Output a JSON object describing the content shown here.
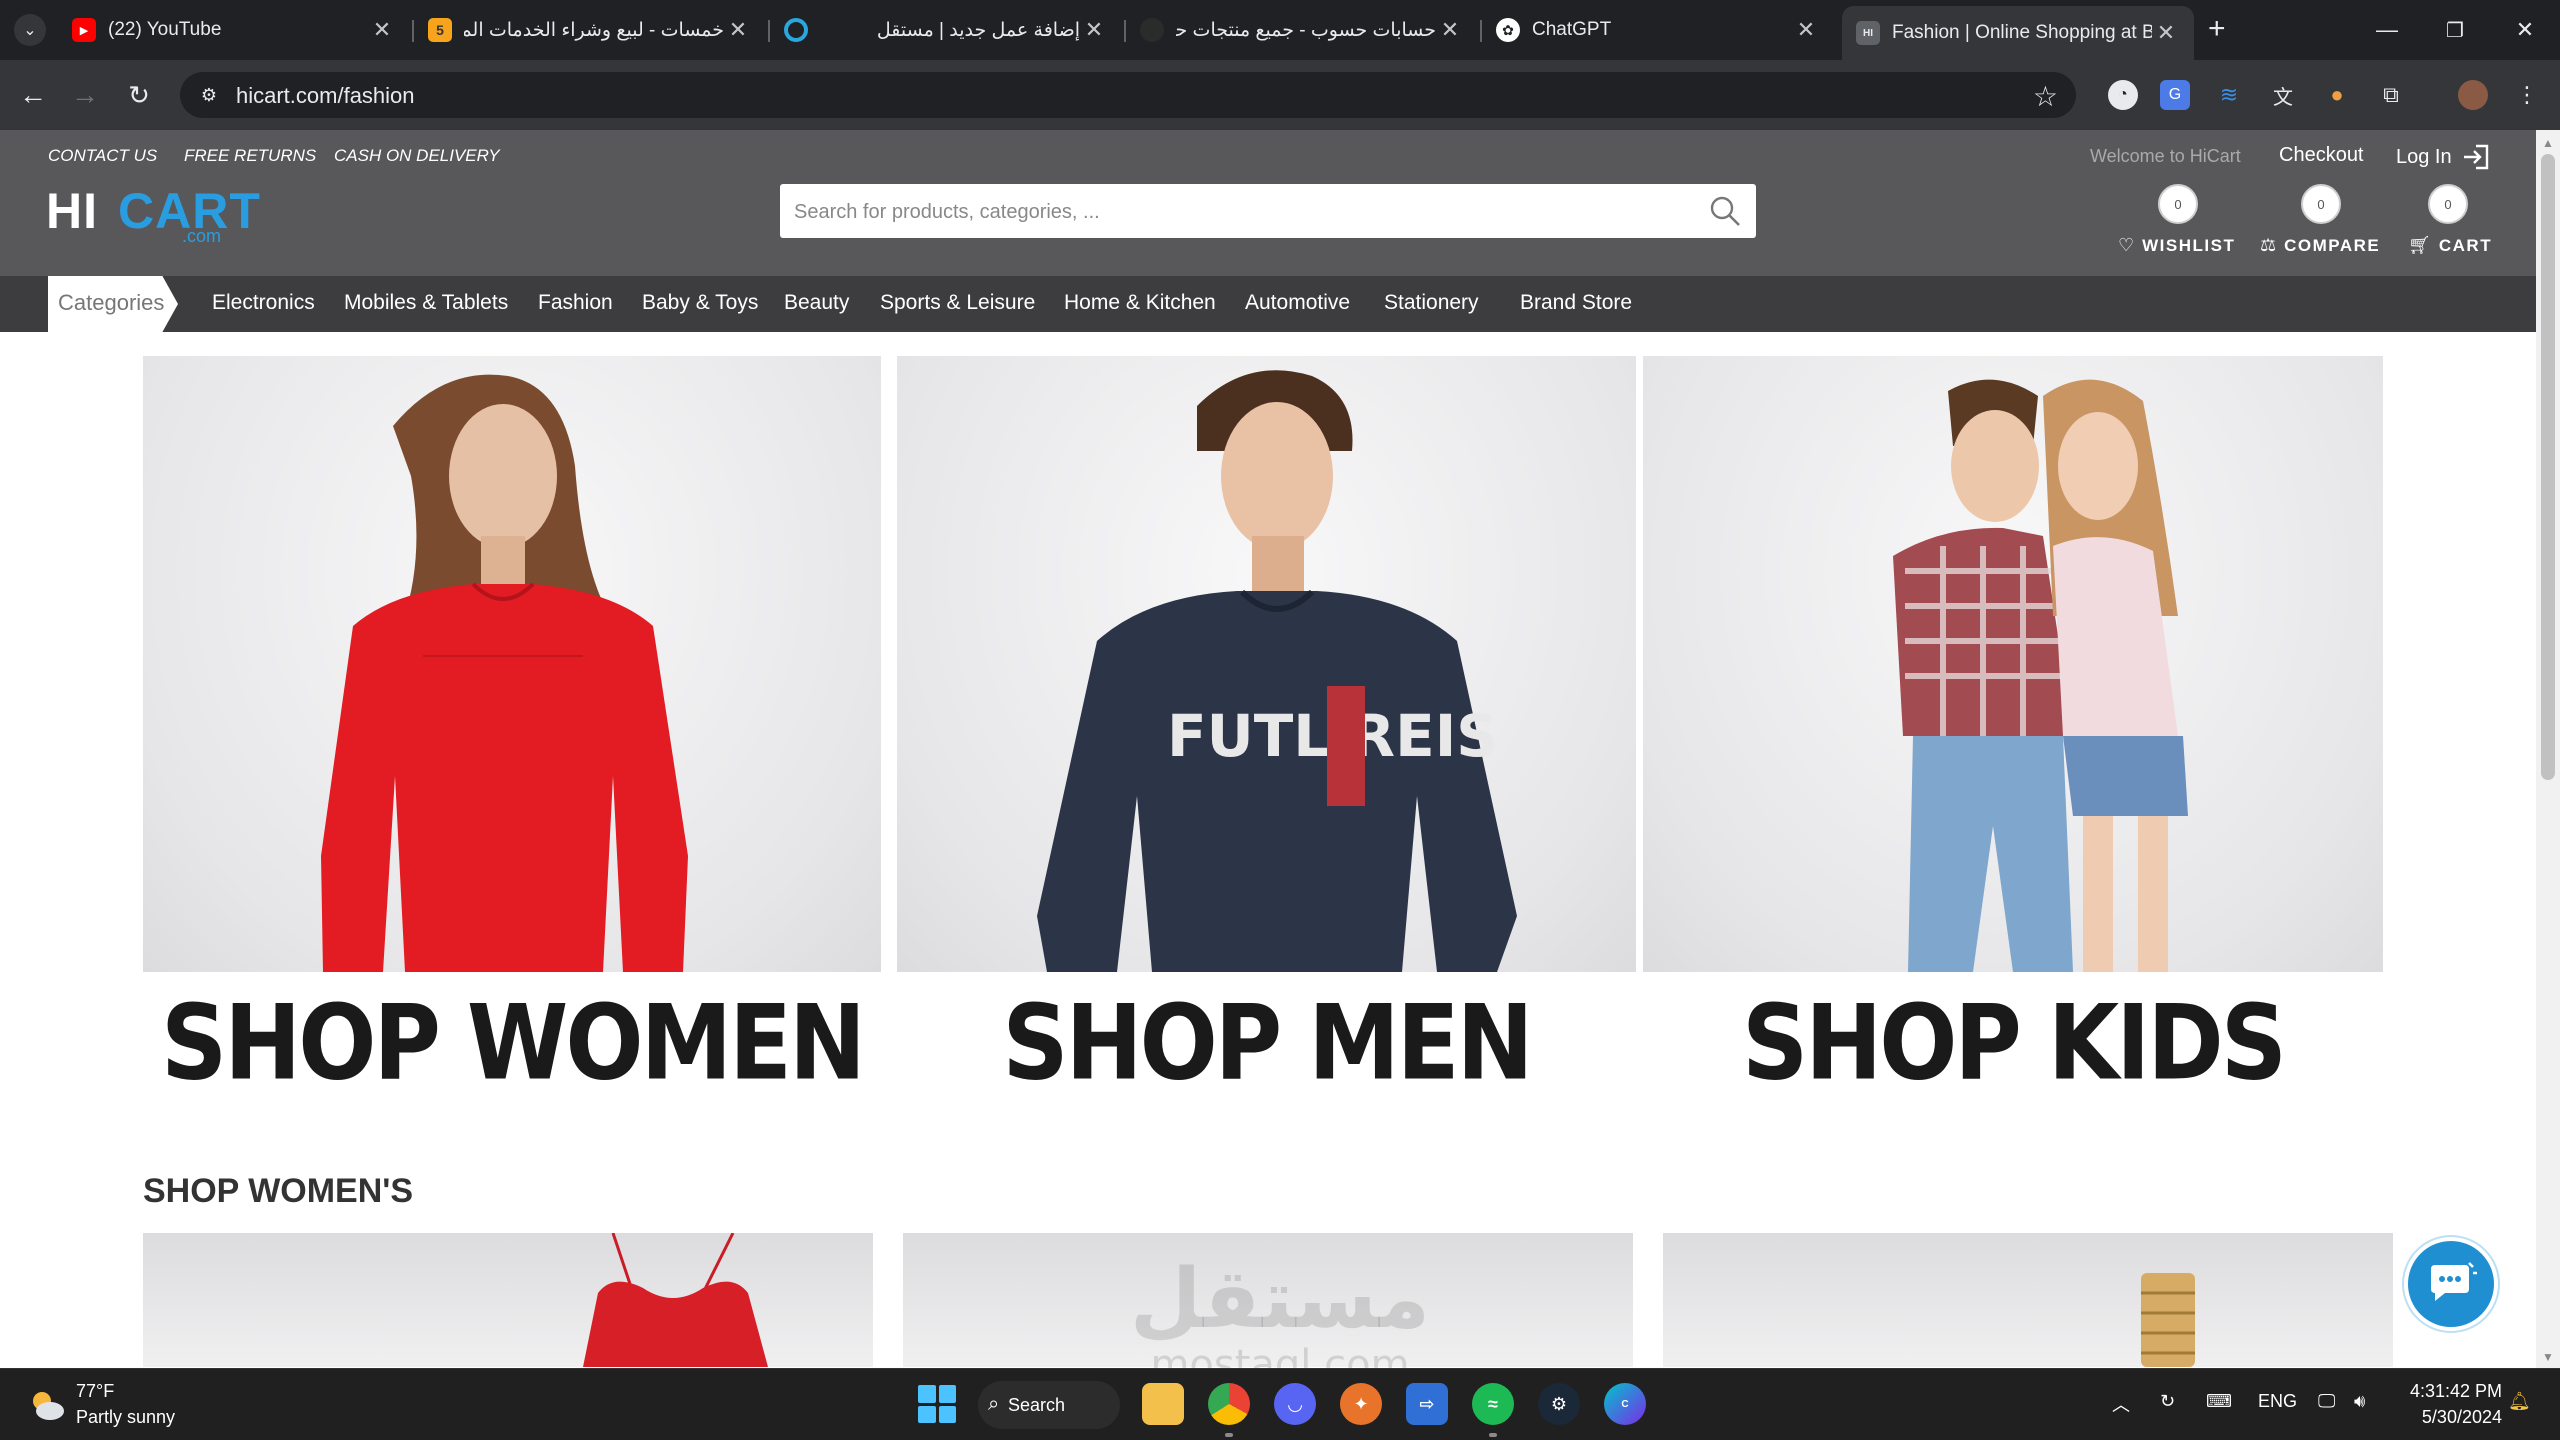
{
  "browser": {
    "tabs": [
      {
        "label": "(22) YouTube",
        "favicon": "youtube-icon",
        "color": "#ff0000"
      },
      {
        "label": "خمسات - لبيع وشراء الخدمات المصغرة",
        "favicon": "khamsat-icon",
        "color": "#f7a41c"
      },
      {
        "label": "إضافة عمل جديد | مستقل",
        "favicon": "mostaql-icon",
        "color": "#2aa7df"
      },
      {
        "label": "حسابات حسوب - جميع منتجات حسوب",
        "favicon": "hsoub-icon",
        "color": "#2b2b2b"
      },
      {
        "label": "ChatGPT",
        "favicon": "chatgpt-icon",
        "color": "#ffffff"
      },
      {
        "label": "Fashion | Online Shopping at Best Prices",
        "favicon": "hicart-icon",
        "color": "#9aa0a6"
      }
    ],
    "url": "hicart.com/fashion"
  },
  "header": {
    "top_links": [
      "CONTACT US",
      "FREE RETURNS",
      "CASH ON DELIVERY"
    ],
    "logo": {
      "hi": "HI",
      "cart": "CART",
      "com": ".com"
    },
    "search_placeholder": "Search for products, categories, ...",
    "welcome": "Welcome to HiCart",
    "checkout": "Checkout",
    "login": "Log In",
    "counters": {
      "wishlist": {
        "label": "WISHLIST",
        "count": "0"
      },
      "compare": {
        "label": "COMPARE",
        "count": "0"
      },
      "cart": {
        "label": "CART",
        "count": "0"
      }
    }
  },
  "nav": {
    "categories_label": "Categories",
    "items": [
      "Electronics",
      "Mobiles & Tablets",
      "Fashion",
      "Baby & Toys",
      "Beauty",
      "Sports & Leisure",
      "Home & Kitchen",
      "Automotive",
      "Stationery",
      "Brand Store"
    ]
  },
  "hero": [
    {
      "caption": "SHOP WOMEN"
    },
    {
      "caption": "SHOP MEN"
    },
    {
      "caption": "SHOP KIDS"
    }
  ],
  "sweater_text": "FUTL REIS",
  "section_title": "SHOP WOMEN'S",
  "watermark": {
    "arabic": "مستقل",
    "latin": "mostaql.com"
  },
  "taskbar": {
    "weather_temp": "77°F",
    "weather_desc": "Partly sunny",
    "search_label": "Search",
    "language": "ENG",
    "time": "4:31:42 PM",
    "date": "5/30/2024"
  },
  "colors": {
    "header_bg": "#58585a",
    "nav_bg": "#3d3d3f",
    "brand_blue": "#2a9de0",
    "women_dress": "#e31b23",
    "men_sweater": "#2c3548"
  }
}
